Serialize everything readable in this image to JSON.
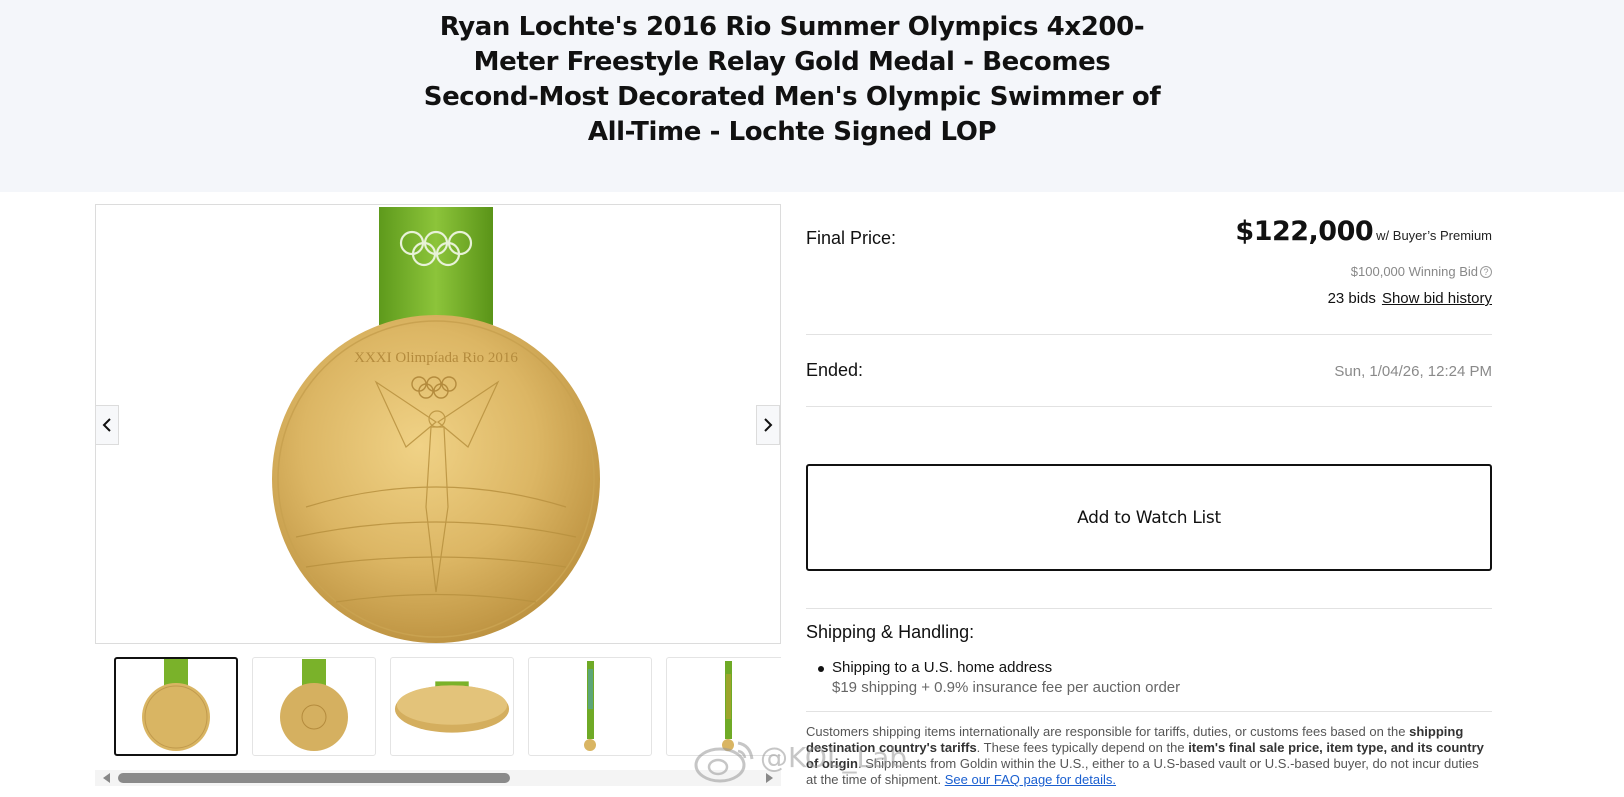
{
  "lot": {
    "title": "Ryan Lochte's 2016 Rio Summer Olympics 4x200-Meter Freestyle Relay Gold Medal - Becomes Second-Most Decorated Men's Olympic Swimmer of All-Time - Lochte Signed LOP"
  },
  "gallery": {
    "prev_icon": "chevron-left-icon",
    "next_icon": "chevron-right-icon",
    "medal_inscription": "XXXI Olimpíada Rio 2016",
    "thumbnail_count": 5,
    "active_thumbnail": 1
  },
  "pricing": {
    "final_price_label": "Final Price:",
    "final_price": "$122,000",
    "premium_suffix": "w/ Buyer’s Premium",
    "winning_bid": "$100,000 Winning Bid",
    "bid_count": "23 bids",
    "bid_history_link": "Show bid history"
  },
  "ended": {
    "label": "Ended:",
    "value": "Sun, 1/04/26, 12:24 PM"
  },
  "watch_button": "Add to Watch List",
  "shipping": {
    "title": "Shipping & Handling:",
    "item_line1": "Shipping to a U.S. home address",
    "item_line2": "$19 shipping + 0.9% insurance fee per auction order",
    "intl_1": "Customers shipping items internationally are responsible for tariffs, duties, or customs fees based on the ",
    "intl_b1": "shipping destination country's tariffs",
    "intl_2": ". These fees typically depend on the ",
    "intl_b2": "item's final sale price, item type, and its country of origin",
    "intl_3": ". Shipments from Goldin within the U.S., either to a U.S-based vault or U.S.-based buyer, do not incur duties at the time of shipment. ",
    "faq_link": "See our FAQ page for details."
  },
  "watermark": {
    "text": "@KOL_Lab"
  },
  "colors": {
    "hero_bg": "#f4f6fa",
    "gold": "#d9b563",
    "ribbon_green": "#7ab22a",
    "link_blue": "#1a5fd0"
  }
}
